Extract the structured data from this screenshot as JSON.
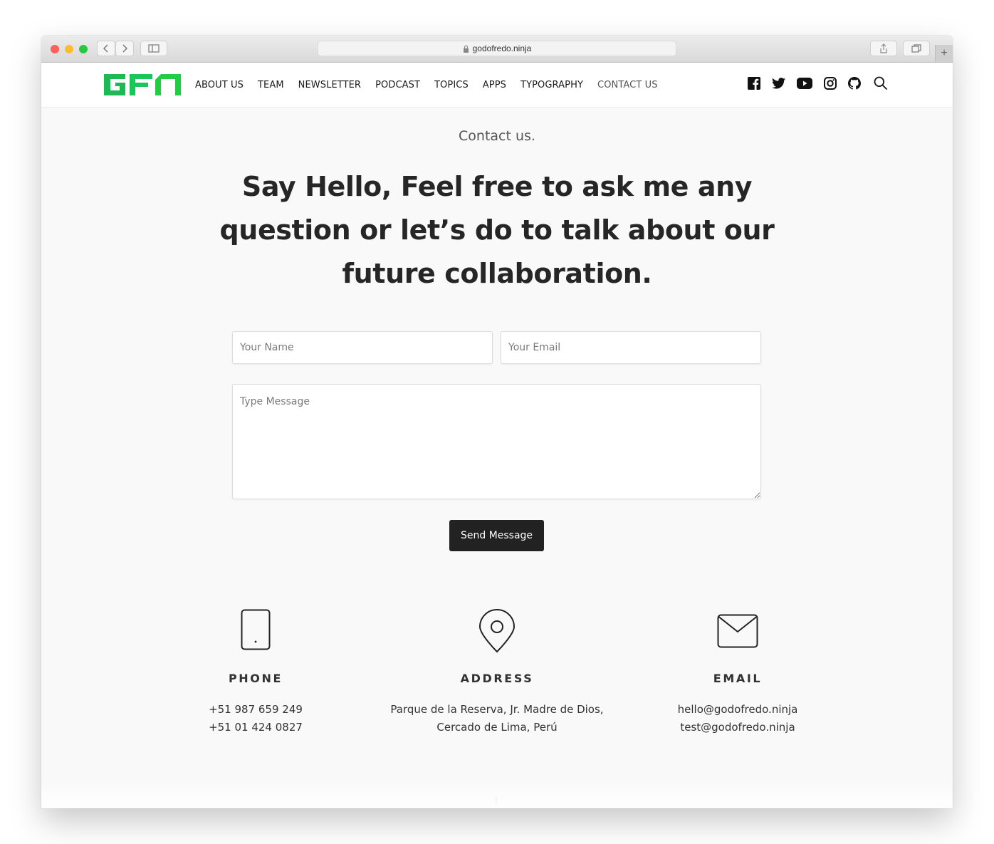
{
  "browser": {
    "url": "godofredo.ninja",
    "traffic_lights": {
      "close": "#ff5f57",
      "minimize": "#febc2e",
      "zoom": "#28c840"
    }
  },
  "nav": {
    "logo_text": "GFN",
    "logo_color": "#1db954",
    "items": [
      {
        "label": "ABOUT US"
      },
      {
        "label": "TEAM"
      },
      {
        "label": "NEWSLETTER"
      },
      {
        "label": "PODCAST"
      },
      {
        "label": "TOPICS"
      },
      {
        "label": "APPS"
      },
      {
        "label": "TYPOGRAPHY"
      },
      {
        "label": "CONTACT US"
      }
    ],
    "social_icons": [
      "facebook-icon",
      "twitter-icon",
      "youtube-icon",
      "instagram-icon",
      "github-icon",
      "search-icon"
    ]
  },
  "contact": {
    "eyebrow": "Contact us.",
    "headline": "Say Hello, Feel free to ask me any question or let’s do to talk about our future collaboration.",
    "form": {
      "name_placeholder": "Your Name",
      "email_placeholder": "Your Email",
      "message_placeholder": "Type Message",
      "submit_label": "Send Message"
    },
    "info": [
      {
        "icon": "phone-icon",
        "title": "PHONE",
        "lines": [
          "+51 987 659 249",
          "+51 01 424 0827"
        ]
      },
      {
        "icon": "map-pin-icon",
        "title": "ADDRESS",
        "lines": [
          "Parque de la Reserva, Jr. Madre de Dios,",
          "Cercado de Lima, Perú"
        ]
      },
      {
        "icon": "mail-icon",
        "title": "EMAIL",
        "lines": [
          "hello@godofredo.ninja",
          "test@godofredo.ninja"
        ]
      }
    ]
  }
}
